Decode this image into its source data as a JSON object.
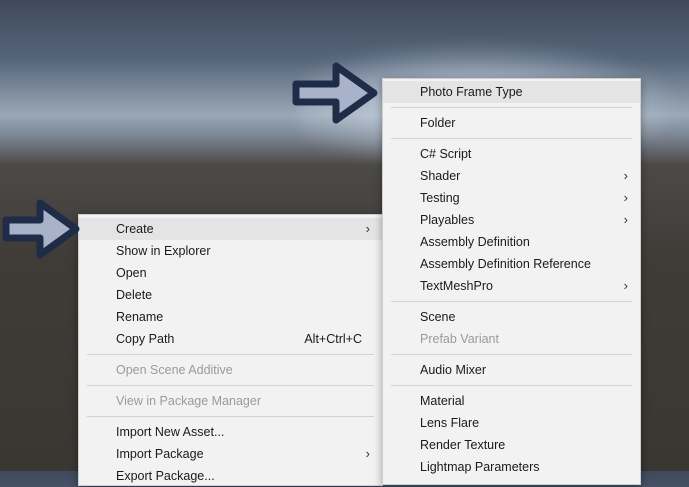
{
  "left_menu": {
    "items": [
      {
        "label": "Create",
        "submenu": true
      },
      {
        "label": "Show in Explorer"
      },
      {
        "label": "Open"
      },
      {
        "label": "Delete"
      },
      {
        "label": "Rename"
      },
      {
        "label": "Copy Path",
        "shortcut": "Alt+Ctrl+C"
      },
      {
        "label": "Open Scene Additive",
        "disabled": true
      },
      {
        "label": "View in Package Manager",
        "disabled": true
      },
      {
        "label": "Import New Asset..."
      },
      {
        "label": "Import Package",
        "submenu": true
      },
      {
        "label": "Export Package..."
      }
    ]
  },
  "right_menu": {
    "items": [
      {
        "label": "Photo Frame Type"
      },
      {
        "label": "Folder"
      },
      {
        "label": "C# Script"
      },
      {
        "label": "Shader",
        "submenu": true
      },
      {
        "label": "Testing",
        "submenu": true
      },
      {
        "label": "Playables",
        "submenu": true
      },
      {
        "label": "Assembly Definition"
      },
      {
        "label": "Assembly Definition Reference"
      },
      {
        "label": "TextMeshPro",
        "submenu": true
      },
      {
        "label": "Scene"
      },
      {
        "label": "Prefab Variant",
        "disabled": true
      },
      {
        "label": "Audio Mixer"
      },
      {
        "label": "Material"
      },
      {
        "label": "Lens Flare"
      },
      {
        "label": "Render Texture"
      },
      {
        "label": "Lightmap Parameters"
      }
    ]
  },
  "chevron_glyph": "›",
  "colors": {
    "arrow_fill": "#a8b3c9",
    "arrow_outline": "#1f2c48",
    "menu_bg": "#f2f2f2",
    "highlight": "#e4e4e4",
    "disabled_text": "#9a9a9a"
  }
}
